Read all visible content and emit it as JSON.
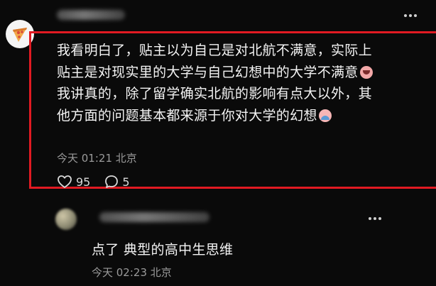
{
  "comment": {
    "author_name": "",
    "text_part1": "我看明白了，贴主以为自己是对北航不满意，实际上贴主是对现实里的大学与自己幻想中的大学不满意",
    "emoji1": "cry-emoji",
    "text_part2": "我讲真的，除了留学确实北航的影响有点大以外，其他方面的问题基本都来源于你对大学的幻想",
    "emoji2": "sob-emoji",
    "meta": "今天 01:21 北京",
    "likes": "95",
    "replies": "5",
    "highlight_color": "#e11a22"
  },
  "reply": {
    "author_name": "",
    "text": "点了 典型的高中生思维",
    "meta": "今天 02:23 北京"
  }
}
